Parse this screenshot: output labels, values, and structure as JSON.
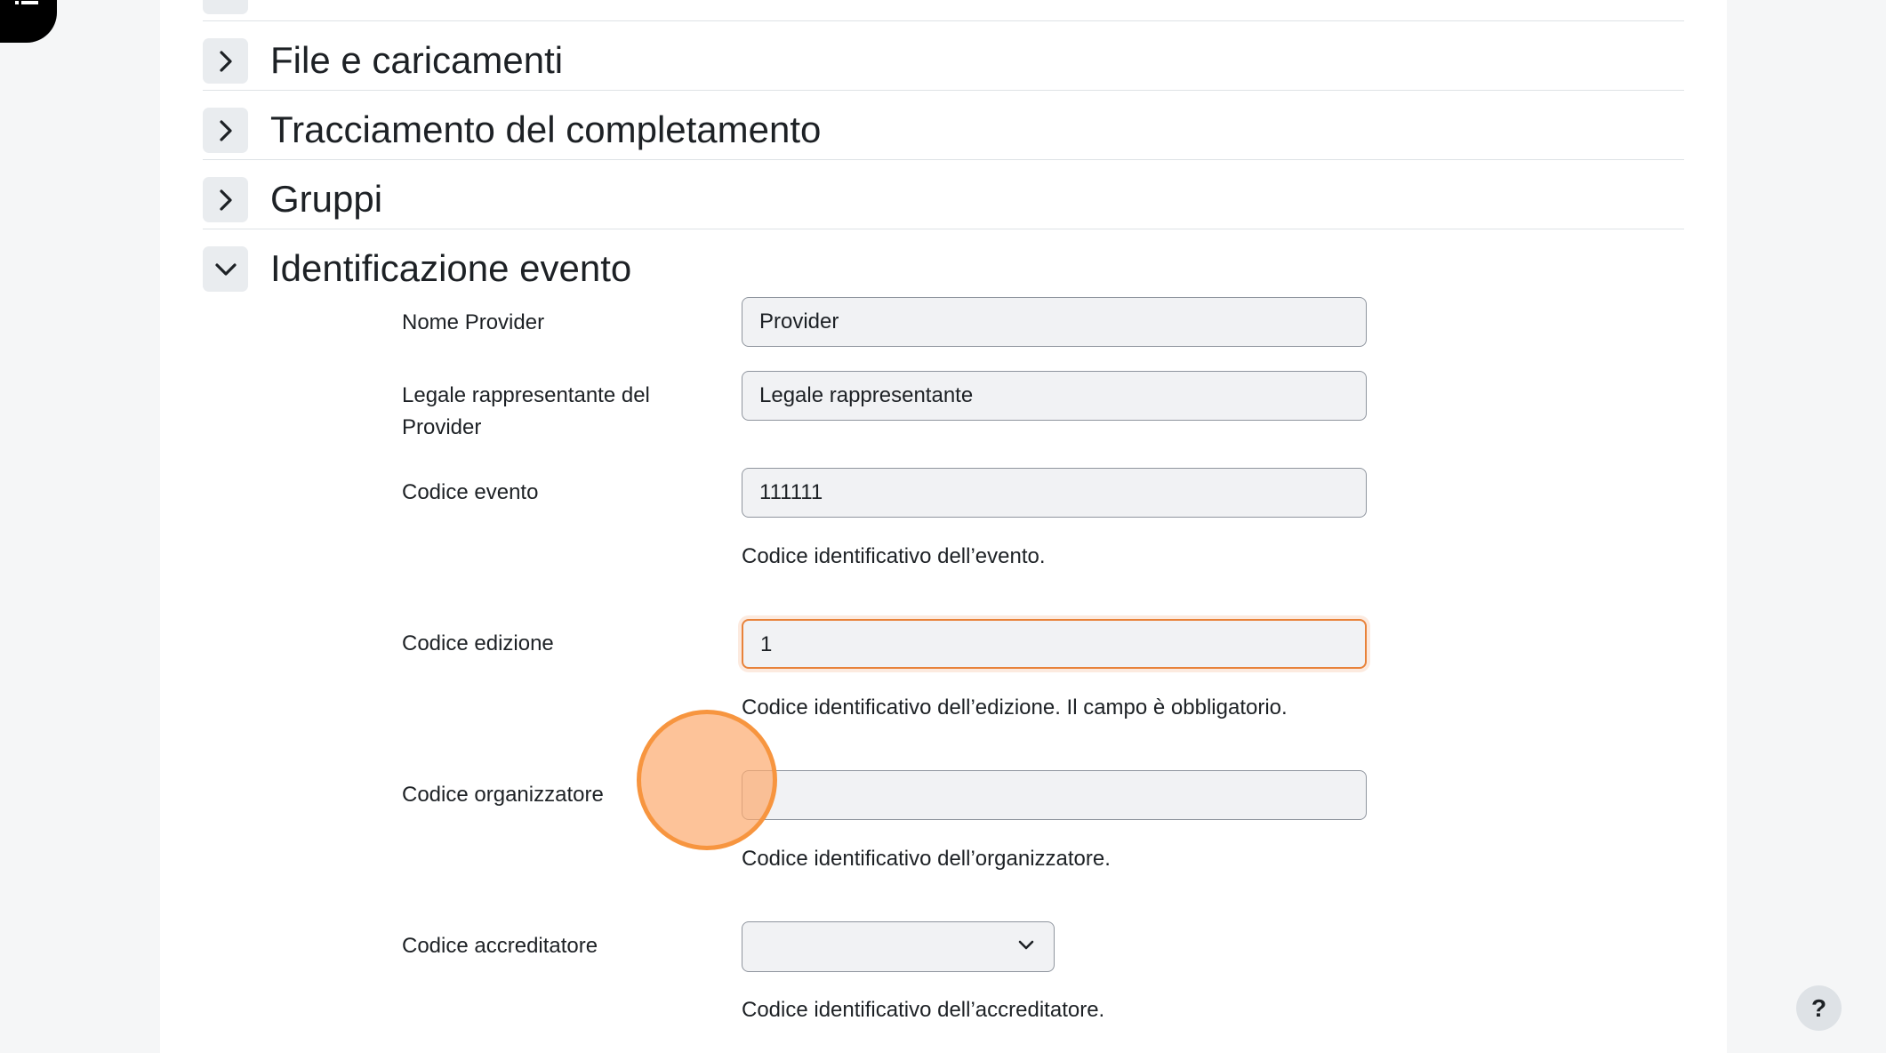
{
  "drawer": {
    "icon": "list-icon"
  },
  "sections": [
    {
      "title": "File e caricamenti",
      "state": "collapsed"
    },
    {
      "title": "Tracciamento del completamento",
      "state": "collapsed"
    },
    {
      "title": "Gruppi",
      "state": "collapsed"
    },
    {
      "title": "Identificazione evento",
      "state": "expanded"
    }
  ],
  "form": {
    "nome_provider": {
      "label": "Nome Provider",
      "value": "Provider"
    },
    "legale_rappresentante": {
      "label": "Legale rappresentante del Provider",
      "value": "Legale rappresentante"
    },
    "codice_evento": {
      "label": "Codice evento",
      "value": "111111",
      "help": "Codice identificativo dell’evento."
    },
    "codice_edizione": {
      "label": "Codice edizione",
      "value": "1",
      "help": "Codice identificativo dell’edizione. Il campo è obbligatorio."
    },
    "codice_organizzatore": {
      "label": "Codice organizzatore",
      "value": "",
      "help": "Codice identificativo dell’organizzatore."
    },
    "codice_accreditatore": {
      "label": "Codice accreditatore",
      "value": "",
      "help": "Codice identificativo dell’accreditatore."
    }
  },
  "help_button": {
    "label": "?"
  },
  "colors": {
    "focus_border": "#e8823a",
    "click_marker": "#f7953f",
    "field_bg": "#f1f2f4"
  }
}
